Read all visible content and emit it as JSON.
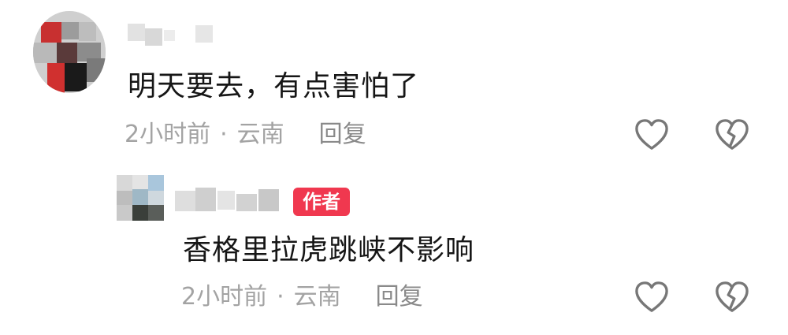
{
  "comments": [
    {
      "text": "明天要去，有点害怕了",
      "time": "2小时前",
      "dot": "·",
      "location": "云南",
      "reply_label": "回复"
    },
    {
      "badge": "作者",
      "text": "香格里拉虎跳峡不影响",
      "time": "2小时前",
      "dot": "·",
      "location": "云南",
      "reply_label": "回复"
    }
  ],
  "icons": {
    "like": "heart-icon",
    "dislike": "broken-heart-icon"
  },
  "colors": {
    "author_badge": "#f0384f",
    "meta_text": "#a3a3a3",
    "icon_stroke": "#777777"
  }
}
